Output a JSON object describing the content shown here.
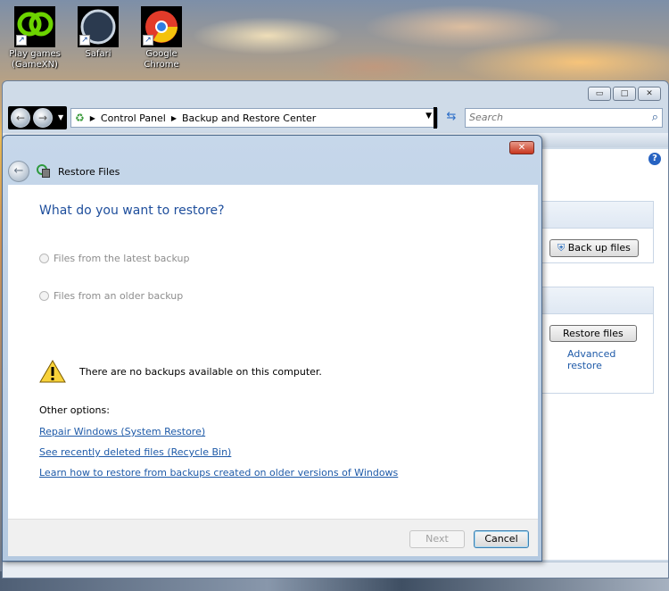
{
  "desktop": {
    "icons": [
      {
        "label_line1": "Play games",
        "label_line2": "(GameXN)",
        "icon": "gamexn-icon"
      },
      {
        "label_line1": "Safari",
        "label_line2": "",
        "icon": "safari-icon"
      },
      {
        "label_line1": "Google",
        "label_line2": "Chrome",
        "icon": "chrome-icon"
      }
    ]
  },
  "explorer": {
    "controls": {
      "minimize": "▭",
      "maximize": "□",
      "close": "✕"
    },
    "breadcrumb": [
      "Control Panel",
      "Backup and Restore Center"
    ],
    "search_placeholder": "Search",
    "backup_button": "Back up files",
    "restore_button": "Restore files",
    "advanced_restore_link": "Advanced restore"
  },
  "dialog": {
    "title": "Restore Files",
    "close_glyph": "✕",
    "heading": "What do you want to restore?",
    "options": [
      {
        "label": "Files from the latest backup",
        "enabled": false
      },
      {
        "label": "Files from an older backup",
        "enabled": false
      }
    ],
    "warning": "There are no backups available on this computer.",
    "other_options_label": "Other options:",
    "links": [
      "Repair Windows (System Restore)",
      "See recently deleted files (Recycle Bin)",
      "Learn how to restore from backups created on older versions of Windows"
    ],
    "next_button": "Next",
    "cancel_button": "Cancel"
  },
  "colors": {
    "link": "#1e5aa8",
    "heading": "#1e4e9c",
    "close_button": "#c8361f"
  }
}
